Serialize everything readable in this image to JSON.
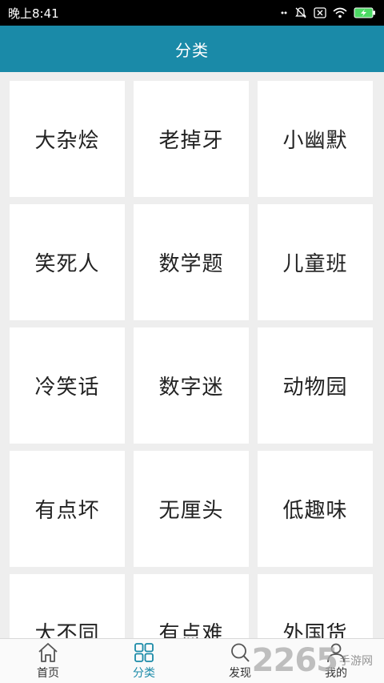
{
  "status_bar": {
    "time": "晚上8:41"
  },
  "header": {
    "title": "分类"
  },
  "categories": [
    "大杂烩",
    "老掉牙",
    "小幽默",
    "笑死人",
    "数学题",
    "儿童班",
    "冷笑话",
    "数字迷",
    "动物园",
    "有点坏",
    "无厘头",
    "低趣味",
    "大不同",
    "有点难",
    "外国货"
  ],
  "tabs": [
    {
      "label": "首页",
      "icon": "home-icon",
      "active": false
    },
    {
      "label": "分类",
      "icon": "grid-icon",
      "active": true
    },
    {
      "label": "发现",
      "icon": "search-icon",
      "active": false
    },
    {
      "label": "我的",
      "icon": "user-icon",
      "active": false
    }
  ],
  "watermark": {
    "number": "2265",
    "text": "手游网"
  },
  "colors": {
    "accent": "#1a8aa8",
    "tile_bg": "#ffffff",
    "page_bg": "#eeeeee"
  }
}
